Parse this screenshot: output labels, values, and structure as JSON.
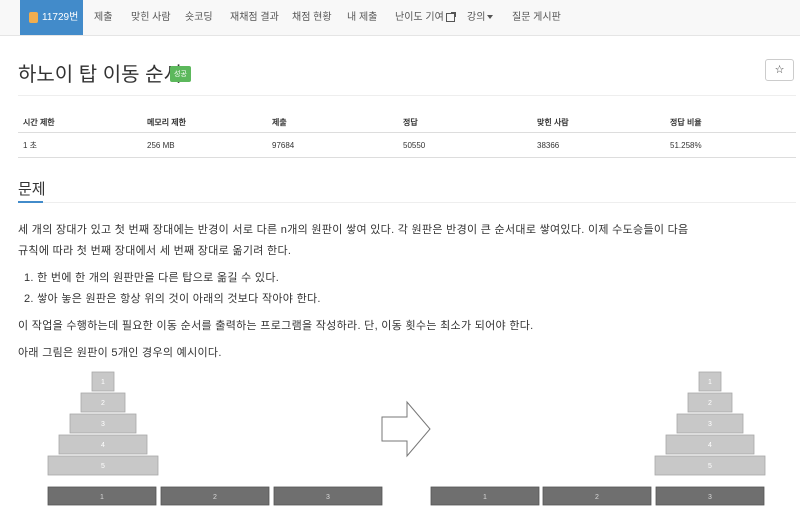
{
  "nav": {
    "problem_number": "11729번",
    "items": [
      "제출",
      "맞힌 사람",
      "숏코딩",
      "재채점 결과",
      "채점 현황",
      "내 제출",
      "난이도 기여",
      "강의",
      "질문 게시판"
    ]
  },
  "problem": {
    "title": "하노이 탑 이동 순서",
    "status": "성공",
    "star": "☆"
  },
  "info_table": {
    "headers": [
      "시간 제한",
      "메모리 제한",
      "제출",
      "정답",
      "맞힌 사람",
      "정답 비율"
    ],
    "values": [
      "1 초",
      "256 MB",
      "97684",
      "50550",
      "38366",
      "51.258%"
    ]
  },
  "section": {
    "title": "문제",
    "lines": [
      "세 개의 장대가 있고 첫 번째 장대에는 반경이 서로 다른 n개의 원판이 쌓여 있다. 각 원판은 반경이 큰 순서대로 쌓여있다. 이제 수도승들이 다음",
      "규칙에 따라 첫 번째 장대에서 세 번째 장대로 옮기려 한다.",
      "1.  한 번에 한 개의 원판만을 다른 탑으로 옮길 수 있다.",
      "2.  쌓아 놓은 원판은 항상 위의 것이 아래의 것보다 작아야 한다.",
      "이 작업을 수행하는데 필요한 이동 순서를 출력하는 프로그램을 작성하라. 단, 이동 횟수는 최소가 되어야 한다.",
      "아래 그림은 원판이 5개인 경우의 예시이다."
    ]
  },
  "figure": {
    "disks": [
      "1",
      "2",
      "3",
      "4",
      "5"
    ],
    "rods": [
      "1",
      "2",
      "3"
    ]
  },
  "colors": {
    "brand": "#428bca",
    "success": "#5cb85c",
    "disk": "#c8c8c8",
    "rod": "#6f6f6f"
  }
}
